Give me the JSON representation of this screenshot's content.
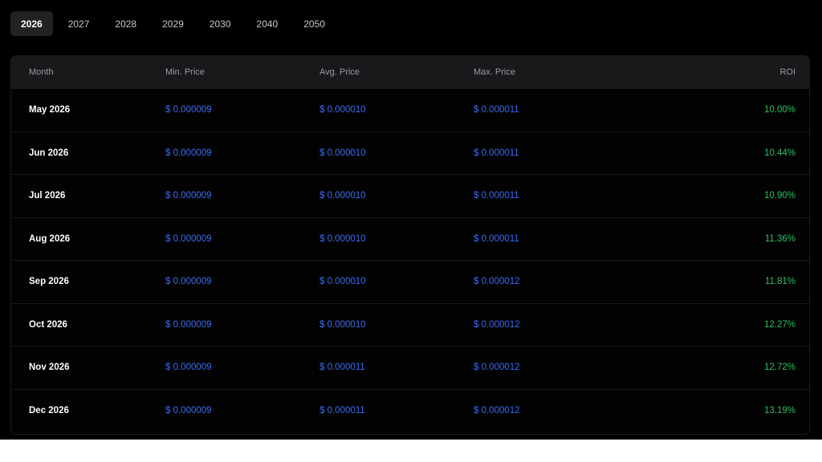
{
  "tabs": [
    "2026",
    "2027",
    "2028",
    "2029",
    "2030",
    "2040",
    "2050"
  ],
  "active_tab": "2026",
  "table": {
    "headers": {
      "month": "Month",
      "min": "Min. Price",
      "avg": "Avg. Price",
      "max": "Max. Price",
      "roi": "ROI"
    },
    "rows": [
      {
        "month": "May 2026",
        "min": "$ 0.000009",
        "avg": "$ 0.000010",
        "max": "$ 0.000011",
        "roi": "10.00%"
      },
      {
        "month": "Jun 2026",
        "min": "$ 0.000009",
        "avg": "$ 0.000010",
        "max": "$ 0.000011",
        "roi": "10.44%"
      },
      {
        "month": "Jul 2026",
        "min": "$ 0.000009",
        "avg": "$ 0.000010",
        "max": "$ 0.000011",
        "roi": "10.90%"
      },
      {
        "month": "Aug 2026",
        "min": "$ 0.000009",
        "avg": "$ 0.000010",
        "max": "$ 0.000011",
        "roi": "11.36%"
      },
      {
        "month": "Sep 2026",
        "min": "$ 0.000009",
        "avg": "$ 0.000010",
        "max": "$ 0.000012",
        "roi": "11.81%"
      },
      {
        "month": "Oct 2026",
        "min": "$ 0.000009",
        "avg": "$ 0.000010",
        "max": "$ 0.000012",
        "roi": "12.27%"
      },
      {
        "month": "Nov 2026",
        "min": "$ 0.000009",
        "avg": "$ 0.000011",
        "max": "$ 0.000012",
        "roi": "12.72%"
      },
      {
        "month": "Dec 2026",
        "min": "$ 0.000009",
        "avg": "$ 0.000011",
        "max": "$ 0.000012",
        "roi": "13.19%"
      }
    ]
  },
  "colors": {
    "background": "#000000",
    "price": "#3b6df2",
    "roi": "#2fbf5f",
    "active_tab_bg": "#222225"
  }
}
